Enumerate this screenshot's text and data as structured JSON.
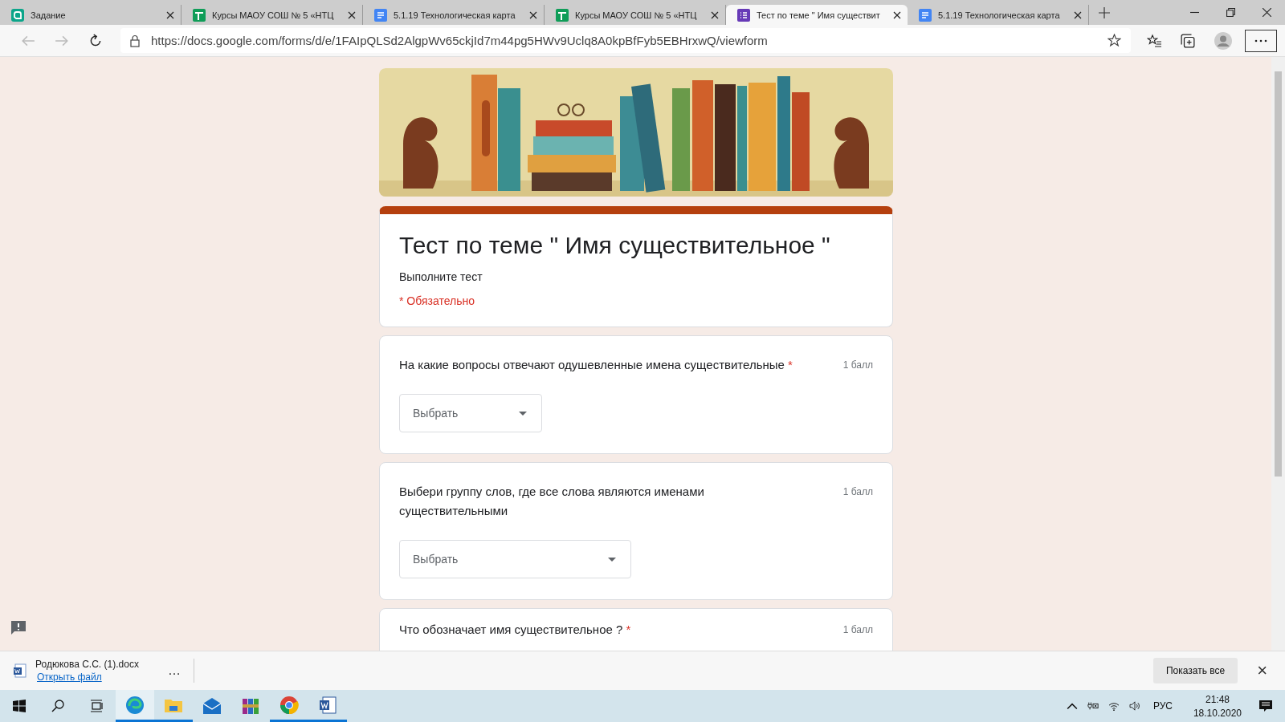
{
  "browser": {
    "tabs": [
      {
        "title": "Задание",
        "kind": "app",
        "selected": false
      },
      {
        "title": "Курсы МАОУ СОШ № 5 «НТЦ",
        "kind": "sheets",
        "selected": false
      },
      {
        "title": "5.1.19 Технологическая карта",
        "kind": "docs",
        "selected": false
      },
      {
        "title": "Курсы МАОУ СОШ № 5 «НТЦ",
        "kind": "sheets",
        "selected": false
      },
      {
        "title": "Тест по теме \" Имя существит",
        "kind": "forms",
        "selected": true
      },
      {
        "title": "5.1.19 Технологическая карта",
        "kind": "docs",
        "selected": false
      }
    ],
    "url": "https://docs.google.com/forms/d/e/1FAIpQLSd2AlgpWv65ckjId7m44pg5HWv9Uclq8A0kpBfFyb5EBHrxwQ/viewform"
  },
  "form": {
    "title": "Тест по теме \" Имя существительное \"",
    "description": "Выполните тест",
    "required_note": "* Обязательно",
    "questions": [
      {
        "text": "На какие вопросы отвечают одушевленные имена существительные",
        "required_mark": "*",
        "points": "1 балл",
        "placeholder": "Выбрать"
      },
      {
        "text": "Выбери группу слов, где все слова являются именами существительными",
        "points": "1 балл",
        "placeholder": "Выбрать"
      },
      {
        "text": "Что обозначает имя существительное ?",
        "required_mark": "*",
        "points": "1 балл"
      }
    ]
  },
  "download_bar": {
    "file": "Родюкова С.С. (1).docx",
    "open_link": "Открыть файл",
    "more": "…",
    "show_all": "Показать все",
    "close": "×"
  },
  "taskbar": {
    "apps": [
      {
        "kind": "edge",
        "running": true,
        "selected": true
      },
      {
        "kind": "explorer",
        "running": true,
        "selected": false
      },
      {
        "kind": "mail",
        "running": false,
        "selected": false
      },
      {
        "kind": "winrar",
        "running": false,
        "selected": false
      },
      {
        "kind": "chrome",
        "running": true,
        "selected": false
      },
      {
        "kind": "word",
        "running": true,
        "selected": false
      }
    ],
    "language": "РУС",
    "time": "21:48",
    "date": "18.10.2020"
  }
}
